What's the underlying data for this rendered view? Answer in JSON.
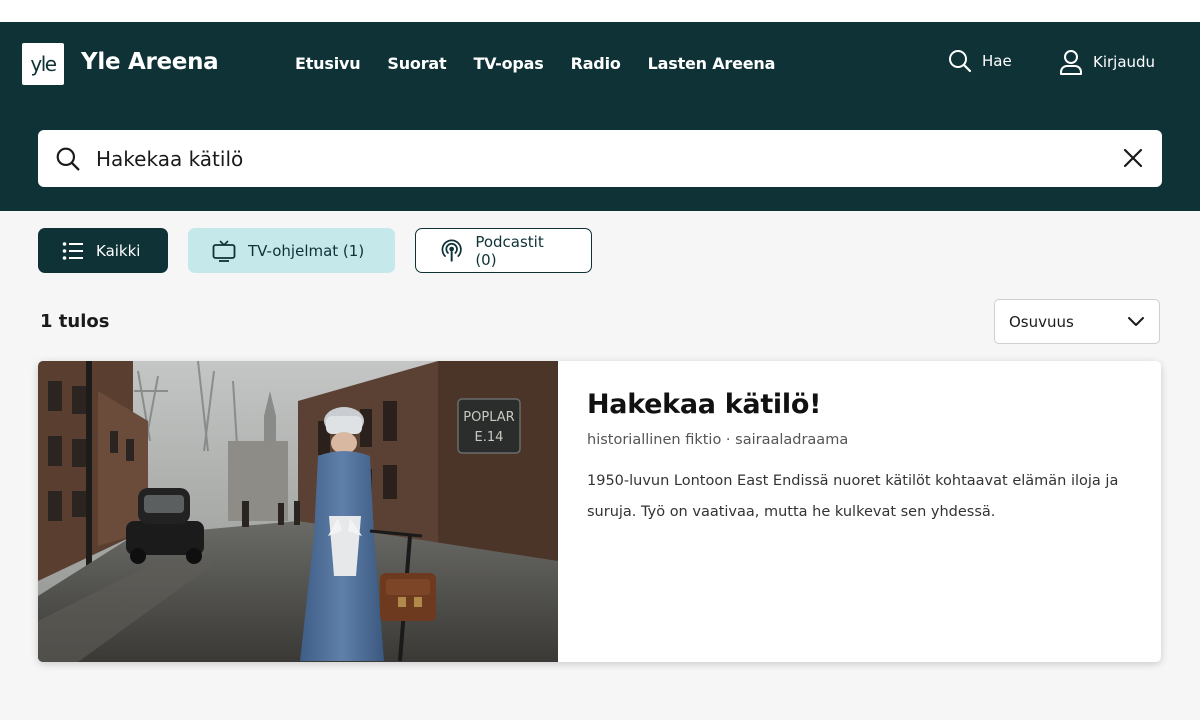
{
  "header": {
    "logo_text": "yle",
    "brand": "Yle Areena",
    "nav": [
      "Etusivu",
      "Suorat",
      "TV-opas",
      "Radio",
      "Lasten Areena"
    ],
    "search_label": "Hae",
    "login_label": "Kirjaudu"
  },
  "search": {
    "value": "Hakekaa kätilö",
    "icon": "search-icon",
    "clear_icon": "close-icon"
  },
  "filters": [
    {
      "label": "Kaikki",
      "icon": "list-icon",
      "active": true
    },
    {
      "label": "TV-ohjelmat (1)",
      "icon": "tv-icon",
      "active": false
    },
    {
      "label": "Podcastit (0)",
      "icon": "podcast-icon",
      "active": false
    }
  ],
  "results": {
    "count_label": "1 tulos",
    "sort": "Osuvuus",
    "items": [
      {
        "title": "Hakekaa kätilö!",
        "genre": "historiallinen fiktio · sairaaladraama",
        "description": "1950-luvun Lontoon East Endissä nuoret kätilöt kohtaavat elämän iloja ja suruja. Työ on vaativaa, mutta he kulkevat sen yhdessä.",
        "thumbnail_sign": [
          "POPLAR",
          "E.14"
        ]
      }
    ]
  },
  "colors": {
    "header_bg": "#0e3236",
    "chip_tv_bg": "#c5e8eb",
    "page_bg": "#f6f6f6"
  }
}
